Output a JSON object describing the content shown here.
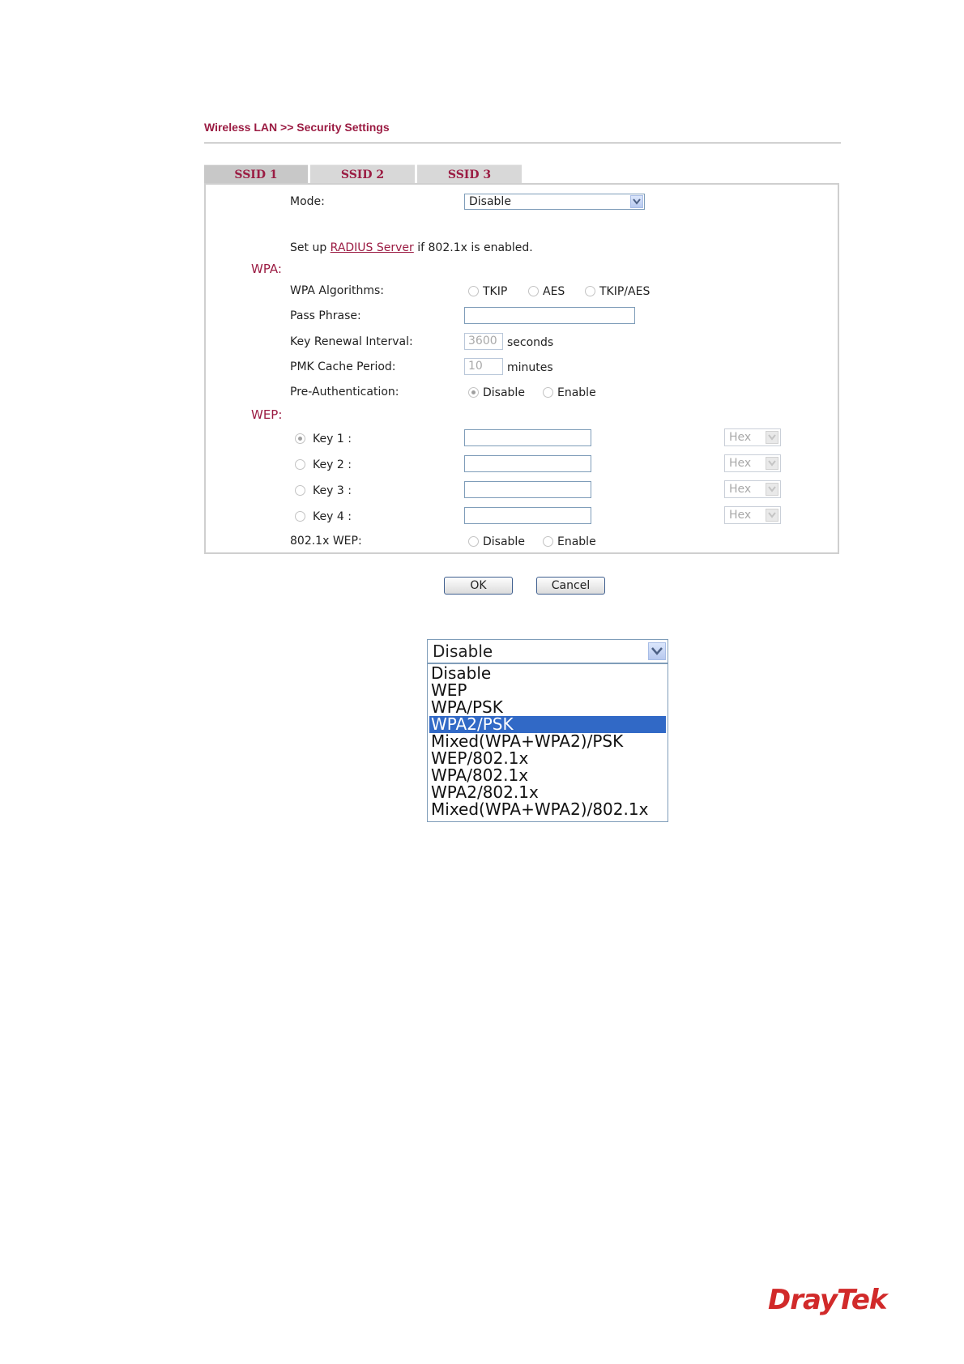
{
  "breadcrumb": "Wireless LAN >> Security Settings",
  "tabs": [
    {
      "label": "SSID 1",
      "active": true
    },
    {
      "label": "SSID 2",
      "active": false
    },
    {
      "label": "SSID 3",
      "active": false
    }
  ],
  "mode": {
    "label": "Mode:",
    "value": "Disable"
  },
  "radius_note": {
    "prefix": "Set up ",
    "link": "RADIUS Server",
    "suffix": " if 802.1x is enabled."
  },
  "wpa": {
    "title": "WPA:",
    "algorithms": {
      "label": "WPA Algorithms:",
      "options": [
        "TKIP",
        "AES",
        "TKIP/AES"
      ]
    },
    "pass_phrase": {
      "label": "Pass Phrase:",
      "value": ""
    },
    "key_renewal": {
      "label": "Key Renewal Interval:",
      "value": "3600",
      "unit": "seconds"
    },
    "pmk_cache": {
      "label": "PMK Cache Period:",
      "value": "10",
      "unit": "minutes"
    },
    "pre_auth": {
      "label": "Pre-Authentication:",
      "options": [
        "Disable",
        "Enable"
      ],
      "selected": "Disable"
    }
  },
  "wep": {
    "title": "WEP:",
    "keys": [
      {
        "label": "Key 1 :",
        "selected": true,
        "format": "Hex"
      },
      {
        "label": "Key 2 :",
        "selected": false,
        "format": "Hex"
      },
      {
        "label": "Key 3 :",
        "selected": false,
        "format": "Hex"
      },
      {
        "label": "Key 4 :",
        "selected": false,
        "format": "Hex"
      }
    ],
    "dot1x": {
      "label": "802.1x WEP:",
      "options": [
        "Disable",
        "Enable"
      ]
    }
  },
  "buttons": {
    "ok": "OK",
    "cancel": "Cancel"
  },
  "dropdown": {
    "current": "Disable",
    "options": [
      "Disable",
      "WEP",
      "WPA/PSK",
      "WPA2/PSK",
      "Mixed(WPA+WPA2)/PSK",
      "WEP/802.1x",
      "WPA/802.1x",
      "WPA2/802.1x",
      "Mixed(WPA+WPA2)/802.1x"
    ],
    "highlighted": "WPA2/PSK"
  },
  "brand": {
    "name": "DrayTek",
    "color": "#d12a2a"
  },
  "colors": {
    "accent": "#9b1c43",
    "selection": "#3169c6"
  }
}
